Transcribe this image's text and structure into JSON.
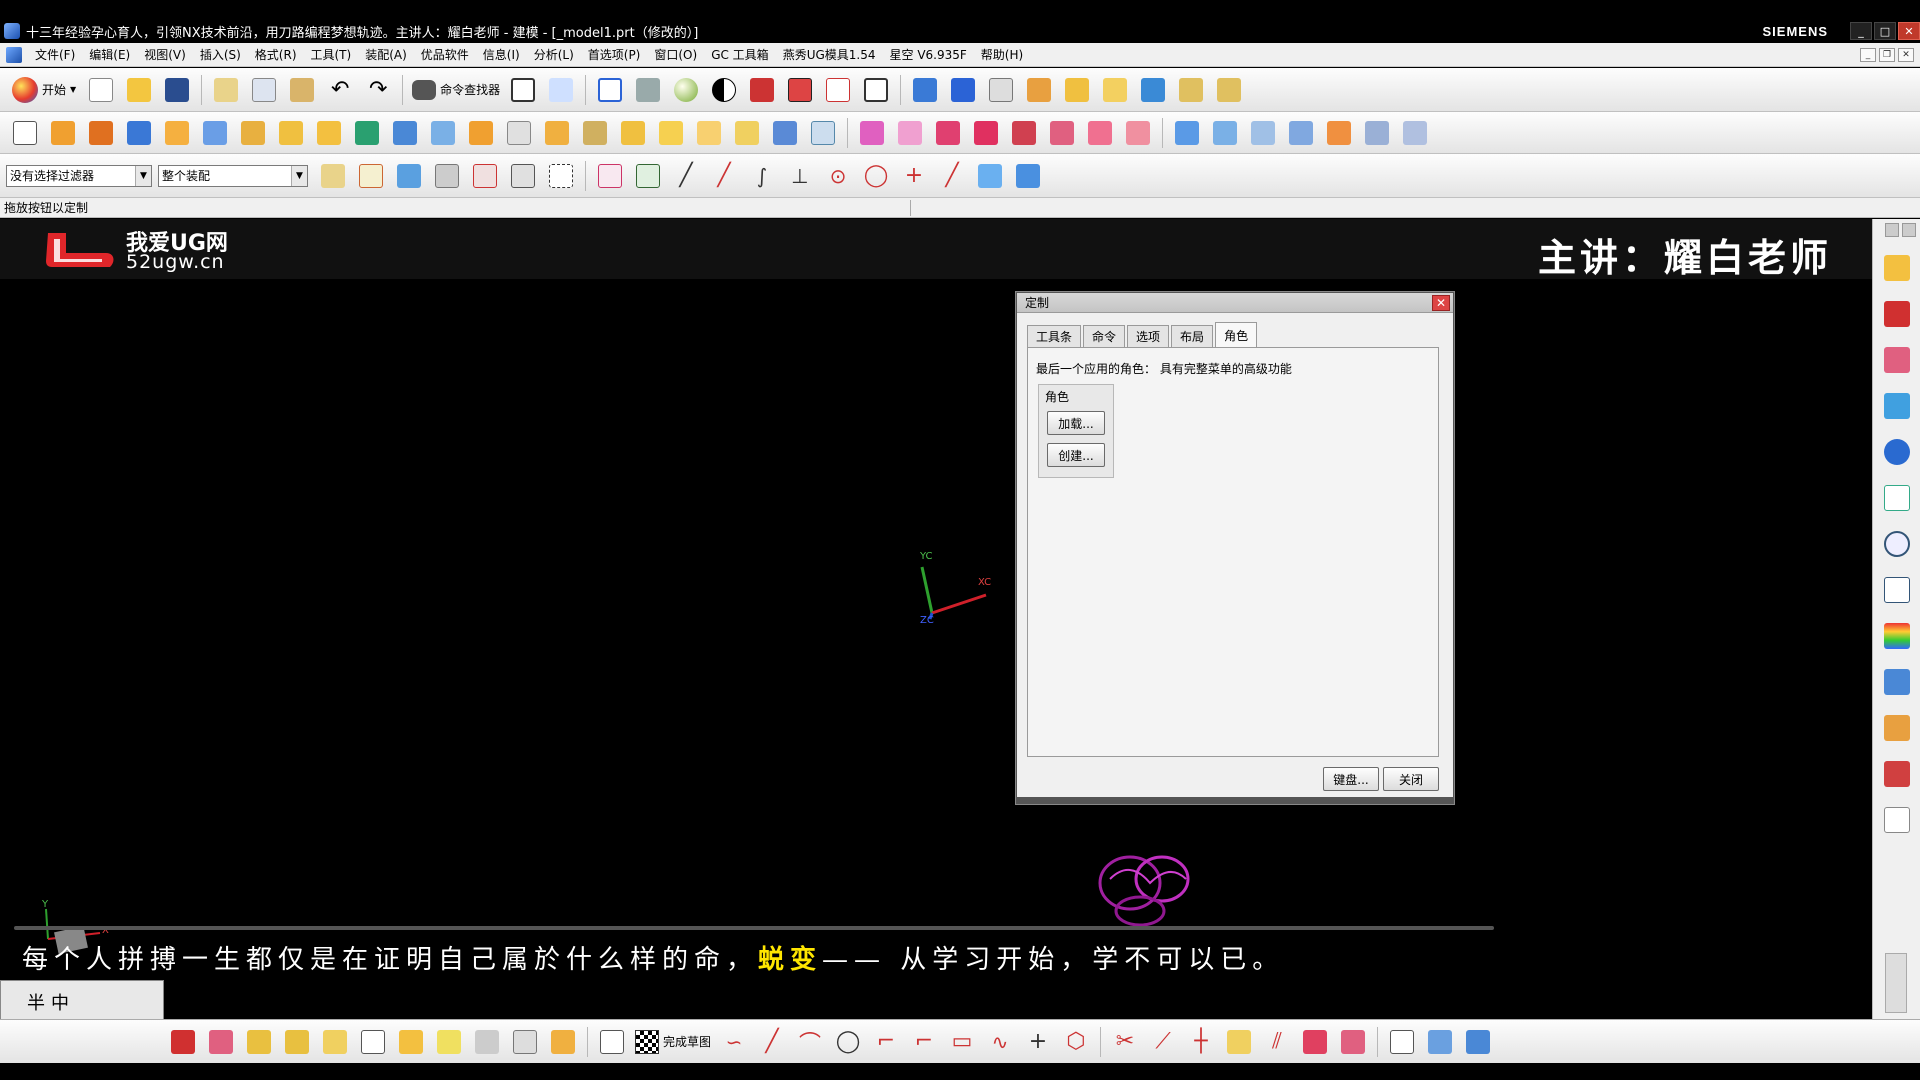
{
  "window": {
    "title": "十三年经验孕心育人，引领NX技术前沿，用刀路编程梦想轨迹。主讲人：耀白老师 - 建模 - [_model1.prt（修改的）]",
    "brand": "SIEMENS"
  },
  "menu": {
    "items": [
      "文件(F)",
      "编辑(E)",
      "视图(V)",
      "插入(S)",
      "格式(R)",
      "工具(T)",
      "装配(A)",
      "优品软件",
      "信息(I)",
      "分析(L)",
      "首选项(P)",
      "窗口(O)",
      "GC 工具箱",
      "燕秀UG模具1.54",
      "星空 V6.935F",
      "帮助(H)"
    ]
  },
  "toolbar1": {
    "start_label": "开始",
    "command_finder_label": "命令查找器"
  },
  "selection": {
    "filter_value": "没有选择过滤器",
    "scope_value": "整个装配"
  },
  "cue_line": "拖放按钮以定制",
  "banner": {
    "logo_cn": "我爱UG网",
    "logo_url": "52ugw.cn",
    "lecturer": "主讲：耀白老师"
  },
  "triad": {
    "yc": "YC",
    "xc": "XC",
    "zc": "ZC"
  },
  "mini_triad": {
    "y": "Y",
    "x": "X"
  },
  "subtitle": {
    "part1": "每个人拼搏一生都仅是在证明自己属於什么样的命，",
    "highlight": "蜕变",
    "part2": "—— 从学习开始，学不可以已。"
  },
  "dialog": {
    "title": "定制",
    "tabs": [
      "工具条",
      "命令",
      "选项",
      "布局",
      "角色"
    ],
    "active_tab": 4,
    "last_role_text": "最后一个应用的角色： 具有完整菜单的高级功能",
    "group_label": "角色",
    "load_button": "加载...",
    "create_button": "创建...",
    "keyboard_button": "键盘...",
    "close_button": "关闭"
  },
  "bottom_toolbar": {
    "finish_sketch_label": "完成草图"
  },
  "ime": {
    "text": "半中"
  },
  "colors": {
    "background": "#000000",
    "toolbar": "#f0f0f0",
    "highlight_subtitle": "#ffe600",
    "cursor_highlight": "#f7e31a",
    "dialog_close": "#dd4444"
  }
}
